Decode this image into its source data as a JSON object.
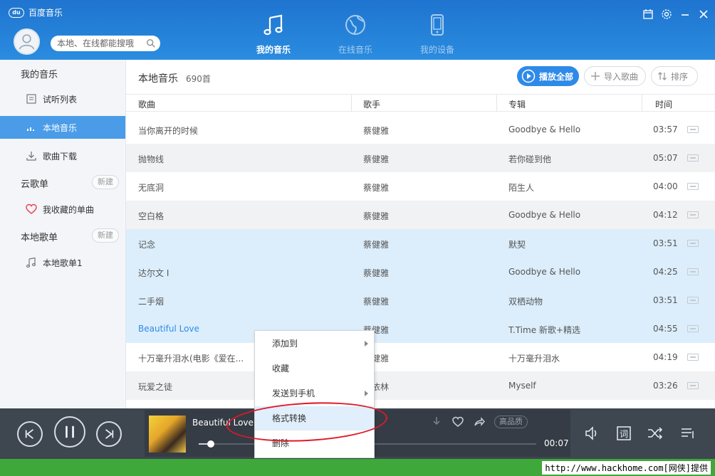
{
  "app": {
    "title": "百度音乐",
    "logo_mark": "du"
  },
  "search": {
    "placeholder": "本地、在线都能搜哦"
  },
  "nav": {
    "tabs": [
      {
        "label": "我的音乐",
        "active": true
      },
      {
        "label": "在线音乐",
        "active": false
      },
      {
        "label": "我的设备",
        "active": false
      }
    ]
  },
  "sidebar": {
    "my_music": "我的音乐",
    "items": [
      {
        "label": "试听列表",
        "icon": "list-icon"
      },
      {
        "label": "本地音乐",
        "icon": "equalizer-icon",
        "active": true
      },
      {
        "label": "歌曲下载",
        "icon": "download-icon"
      }
    ],
    "cloud_heading": "云歌单",
    "cloud_new": "新建",
    "cloud_items": [
      {
        "label": "我收藏的单曲",
        "icon": "heart-icon"
      }
    ],
    "local_heading": "本地歌单",
    "local_new": "新建",
    "local_items": [
      {
        "label": "本地歌单1",
        "icon": "music-note-icon"
      }
    ]
  },
  "main": {
    "title": "本地音乐",
    "count": "690首",
    "play_all": "播放全部",
    "import": "导入歌曲",
    "sort": "排序",
    "columns": [
      "歌曲",
      "歌手",
      "专辑",
      "时间"
    ],
    "rows": [
      {
        "title": "当你离开的时候",
        "artist": "蔡健雅",
        "album": "Goodbye & Hello",
        "time": "03:57",
        "state": "normal"
      },
      {
        "title": "抛物线",
        "artist": "蔡健雅",
        "album": "若你碰到他",
        "time": "05:07",
        "state": "even"
      },
      {
        "title": "无底洞",
        "artist": "蔡健雅",
        "album": "陌生人",
        "time": "04:00",
        "state": "normal"
      },
      {
        "title": "空白格",
        "artist": "蔡健雅",
        "album": "Goodbye & Hello",
        "time": "04:12",
        "state": "even"
      },
      {
        "title": "记念",
        "artist": "蔡健雅",
        "album": "默契",
        "time": "03:51",
        "state": "sel"
      },
      {
        "title": "达尔文 I",
        "artist": "蔡健雅",
        "album": "Goodbye & Hello",
        "time": "04:25",
        "state": "sel"
      },
      {
        "title": "二手烟",
        "artist": "蔡健雅",
        "album": "双栖动物",
        "time": "03:51",
        "state": "sel"
      },
      {
        "title": "Beautiful Love",
        "artist": "蔡健雅",
        "album": "T.Time 新歌+精选",
        "time": "04:55",
        "state": "playing"
      },
      {
        "title": "十万毫升泪水(电影《爱在...",
        "artist": "蔡健雅",
        "album": "十万毫升泪水",
        "time": "04:19",
        "state": "normal"
      },
      {
        "title": "玩爱之徒",
        "artist": "蔡依林",
        "album": "Myself",
        "time": "03:26",
        "state": "even"
      }
    ]
  },
  "player": {
    "track_title": "Beautiful Love",
    "elapsed": "00:07",
    "quality": "高品质",
    "progress": 0.03
  },
  "context_menu": {
    "items": [
      {
        "label": "添加到",
        "submenu": true
      },
      {
        "label": "收藏",
        "submenu": false
      },
      {
        "label": "发送到手机",
        "submenu": true
      },
      {
        "label": "格式转换",
        "submenu": false,
        "highlighted": true
      },
      {
        "label": "删除",
        "submenu": false
      }
    ]
  },
  "watermark": "http://www.hackhome.com[网侠]提供",
  "colors": {
    "header": "#1f74cf",
    "accent": "#2e8ae8",
    "selected_row": "#dceefc",
    "player_bg": "#3e4650",
    "annotation": "#e0192a"
  }
}
